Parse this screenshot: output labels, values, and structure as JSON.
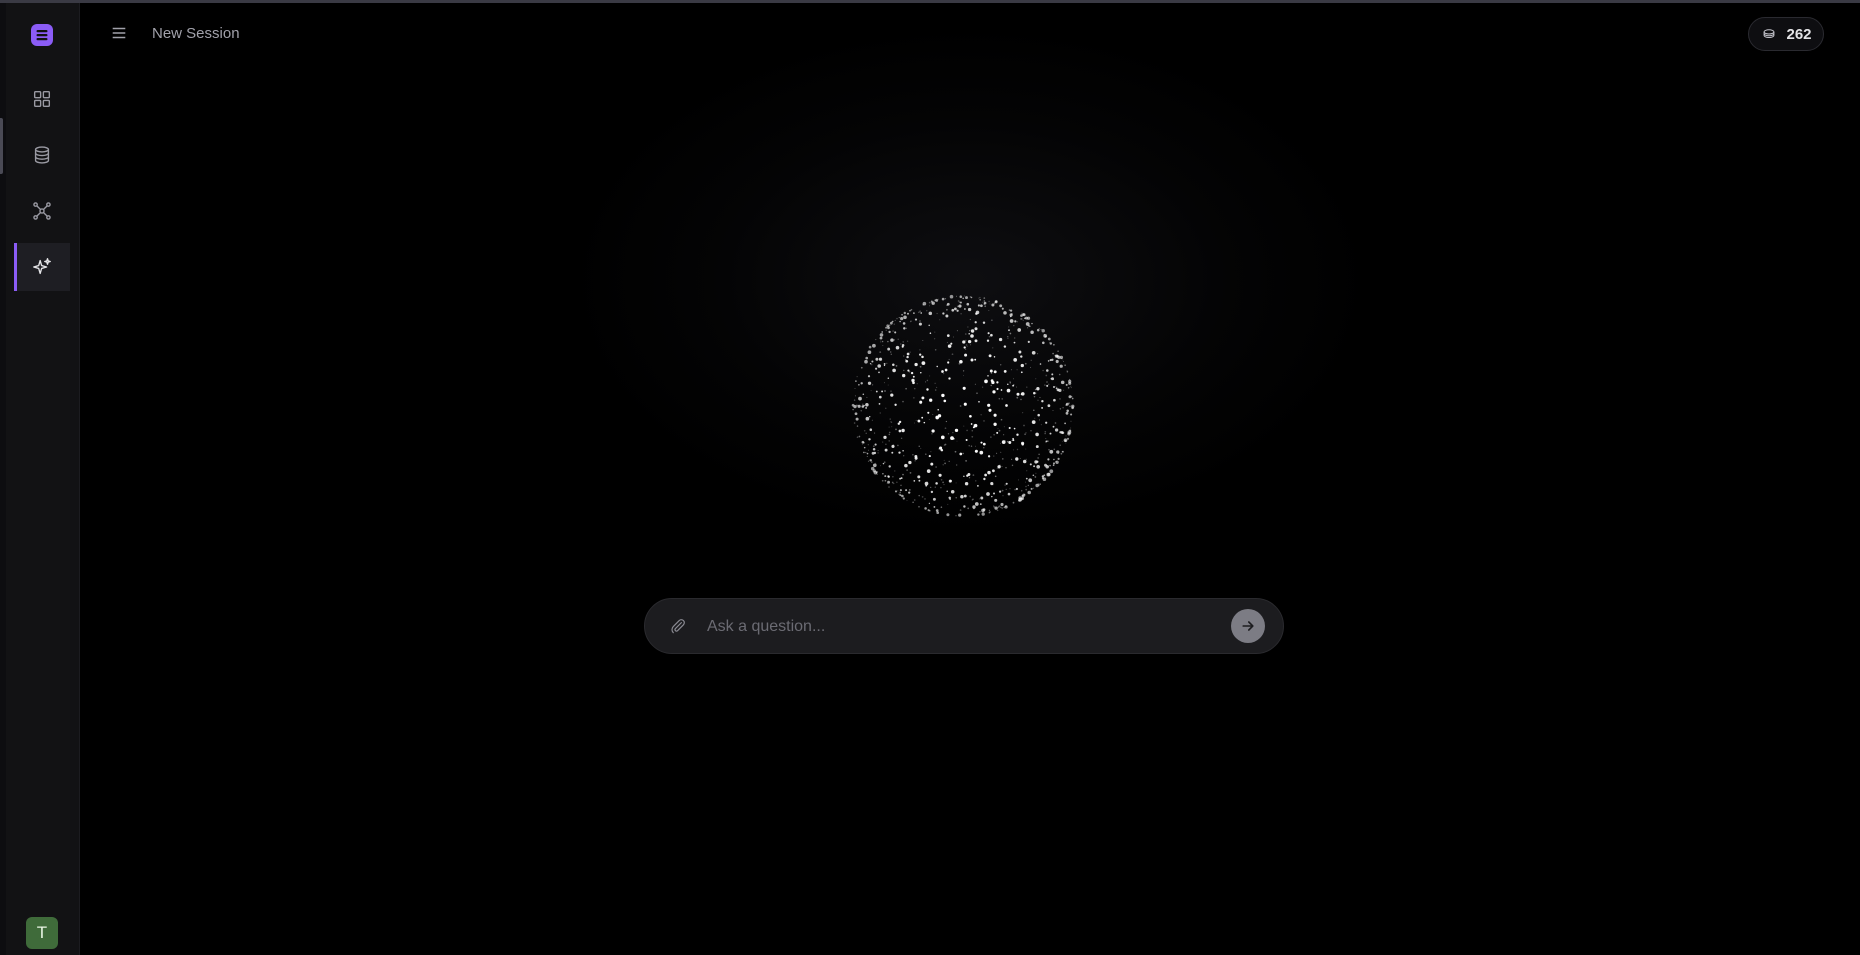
{
  "header": {
    "title": "New Session",
    "credits": "262"
  },
  "sidebar": {
    "items": [
      {
        "name": "dashboard",
        "icon": "grid-icon",
        "active": false
      },
      {
        "name": "database",
        "icon": "database-icon",
        "active": false
      },
      {
        "name": "graph",
        "icon": "graph-nodes-icon",
        "active": false
      },
      {
        "name": "ai-assistant",
        "icon": "sparkles-icon",
        "active": true
      }
    ],
    "user_initial": "T"
  },
  "chat": {
    "placeholder": "Ask a question...",
    "value": ""
  },
  "colors": {
    "accent": "#8b5cf6",
    "background": "#000000",
    "sidebar": "#121214",
    "avatar": "#3f6b3a"
  }
}
